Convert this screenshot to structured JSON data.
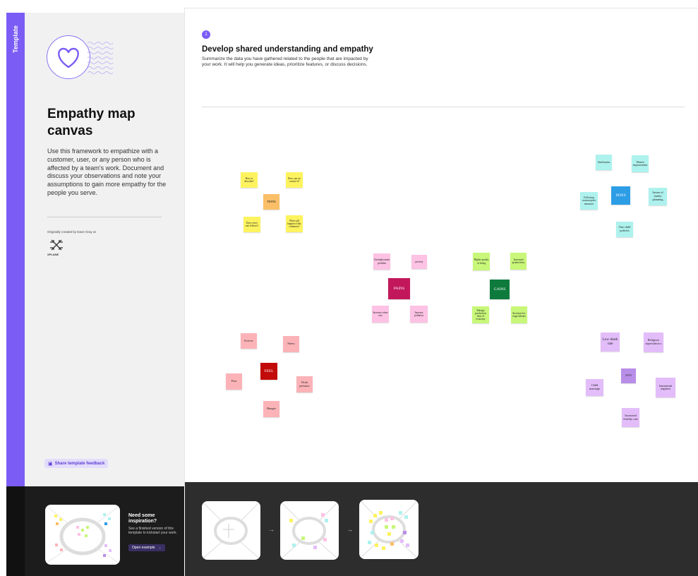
{
  "sidebar": {
    "tab_label": "Template",
    "title": "Empathy map canvas",
    "description": "Use this framework to empathize with a customer, user, or any person who is affected by a team's work. Document and discuss your observations and note your assumptions to gain more empathy for the people you serve.",
    "credit": "Originally created by Dave Gray at",
    "logo_text": "XPLANE",
    "feedback_label": "Share template feedback",
    "inspiration": {
      "title": "Need some inspiration?",
      "body": "See a finished version of this template to kickstart your work.",
      "button_label": "Open example"
    }
  },
  "canvas": {
    "step_number": "1",
    "section_title": "Develop shared understanding and empathy",
    "section_description": "Summarize the data you have gathered related to the people that are impacted by your work. It will help you generate ideas, prioritize features, or discuss decisions.",
    "clusters": {
      "think": {
        "hub": "THINK",
        "notes": [
          "How to describe?",
          "How can we control it?",
          "Does every one follows?",
          "What will happen if this continues?"
        ]
      },
      "does": {
        "hub": "DOES",
        "notes": [
          "Sterilization",
          "Women empowerment",
          "Following contraceptive measures",
          "Aware of family planning",
          "One child policies"
        ]
      },
      "pains": {
        "hub": "PAINS",
        "notes": [
          "Unemployment problem",
          "poverty",
          "Increase crime rate",
          "Increase pollution"
        ]
      },
      "gains": {
        "hub": "GAINS",
        "notes": [
          "Higher quality of living",
          "Increased productivity",
          "Enlarge production base of economy",
          "Increase low wage labours"
        ]
      },
      "feel": {
        "hub": "FEEL",
        "notes": [
          "Sorrow",
          "Stress",
          "Fear",
          "Work pressure",
          "Hunger"
        ]
      },
      "says": {
        "hub": "SAYS",
        "notes": [
          "Low death rate",
          "Religious superstition s",
          "Child marriage",
          "International migration",
          "Increased fertility rate"
        ]
      }
    }
  },
  "colors": {
    "accent": "#7b5cf5",
    "yellow": "#fdf35f",
    "orange": "#fbbf68",
    "cyan": "#aef2ee",
    "blue": "#2d9de6",
    "pink": "#fdc2e4",
    "magenta": "#c2185b",
    "green": "#c8f779",
    "dark_green": "#0e7a3c",
    "salmon": "#fbb3b8",
    "red": "#c20a0a",
    "lavender": "#e3bdfa",
    "purple": "#b98ee8"
  }
}
